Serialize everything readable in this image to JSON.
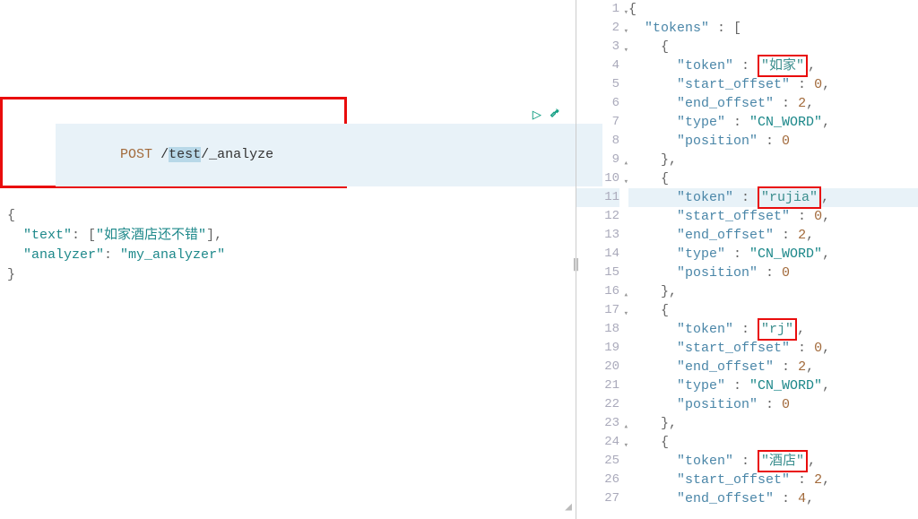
{
  "request": {
    "method": "POST",
    "path_prefix": "/",
    "path_selected": "test",
    "path_suffix": "/_analyze",
    "body_open": "{",
    "body_line1_key": "\"text\"",
    "body_line1_sep": ": [",
    "body_line1_val": "\"如家酒店还不错\"",
    "body_line1_end": "],",
    "body_line2_key": "\"analyzer\"",
    "body_line2_sep": ": ",
    "body_line2_val": "\"my_analyzer\"",
    "body_close": "}"
  },
  "gutter": {
    "1": "1",
    "2": "2",
    "3": "3",
    "4": "4",
    "5": "5",
    "6": "6",
    "7": "7",
    "8": "8",
    "9": "9",
    "10": "10",
    "11": "11",
    "12": "12",
    "13": "13",
    "14": "14",
    "15": "15",
    "16": "16",
    "17": "17",
    "18": "18",
    "19": "19",
    "20": "20",
    "21": "21",
    "22": "22",
    "23": "23",
    "24": "24",
    "25": "25",
    "26": "26",
    "27": "27"
  },
  "resp": {
    "l1": "{",
    "l2_key": "\"tokens\"",
    "l2_sep": " : [",
    "l3": "{",
    "l4_key": "\"token\"",
    "l4_sep": " : ",
    "l4_val": "\"如家\"",
    "l4_end": ",",
    "l5_key": "\"start_offset\"",
    "l5_sep": " : ",
    "l5_val": "0",
    "l5_end": ",",
    "l6_key": "\"end_offset\"",
    "l6_sep": " : ",
    "l6_val": "2",
    "l6_end": ",",
    "l7_key": "\"type\"",
    "l7_sep": " : ",
    "l7_val": "\"CN_WORD\"",
    "l7_end": ",",
    "l8_key": "\"position\"",
    "l8_sep": " : ",
    "l8_val": "0",
    "l9": "},",
    "l10": "{",
    "l11_key": "\"token\"",
    "l11_sep": " : ",
    "l11_val": "\"rujia\"",
    "l11_end": ",",
    "l12_key": "\"start_offset\"",
    "l12_sep": " : ",
    "l12_val": "0",
    "l12_end": ",",
    "l13_key": "\"end_offset\"",
    "l13_sep": " : ",
    "l13_val": "2",
    "l13_end": ",",
    "l14_key": "\"type\"",
    "l14_sep": " : ",
    "l14_val": "\"CN_WORD\"",
    "l14_end": ",",
    "l15_key": "\"position\"",
    "l15_sep": " : ",
    "l15_val": "0",
    "l16": "},",
    "l17": "{",
    "l18_key": "\"token\"",
    "l18_sep": " : ",
    "l18_val": "\"rj\"",
    "l18_end": ",",
    "l19_key": "\"start_offset\"",
    "l19_sep": " : ",
    "l19_val": "0",
    "l19_end": ",",
    "l20_key": "\"end_offset\"",
    "l20_sep": " : ",
    "l20_val": "2",
    "l20_end": ",",
    "l21_key": "\"type\"",
    "l21_sep": " : ",
    "l21_val": "\"CN_WORD\"",
    "l21_end": ",",
    "l22_key": "\"position\"",
    "l22_sep": " : ",
    "l22_val": "0",
    "l23": "},",
    "l24": "{",
    "l25_key": "\"token\"",
    "l25_sep": " : ",
    "l25_val": "\"酒店\"",
    "l25_end": ",",
    "l26_key": "\"start_offset\"",
    "l26_sep": " : ",
    "l26_val": "2",
    "l26_end": ",",
    "l27_key": "\"end_offset\"",
    "l27_sep": " : ",
    "l27_val": "4",
    "l27_end": ","
  }
}
